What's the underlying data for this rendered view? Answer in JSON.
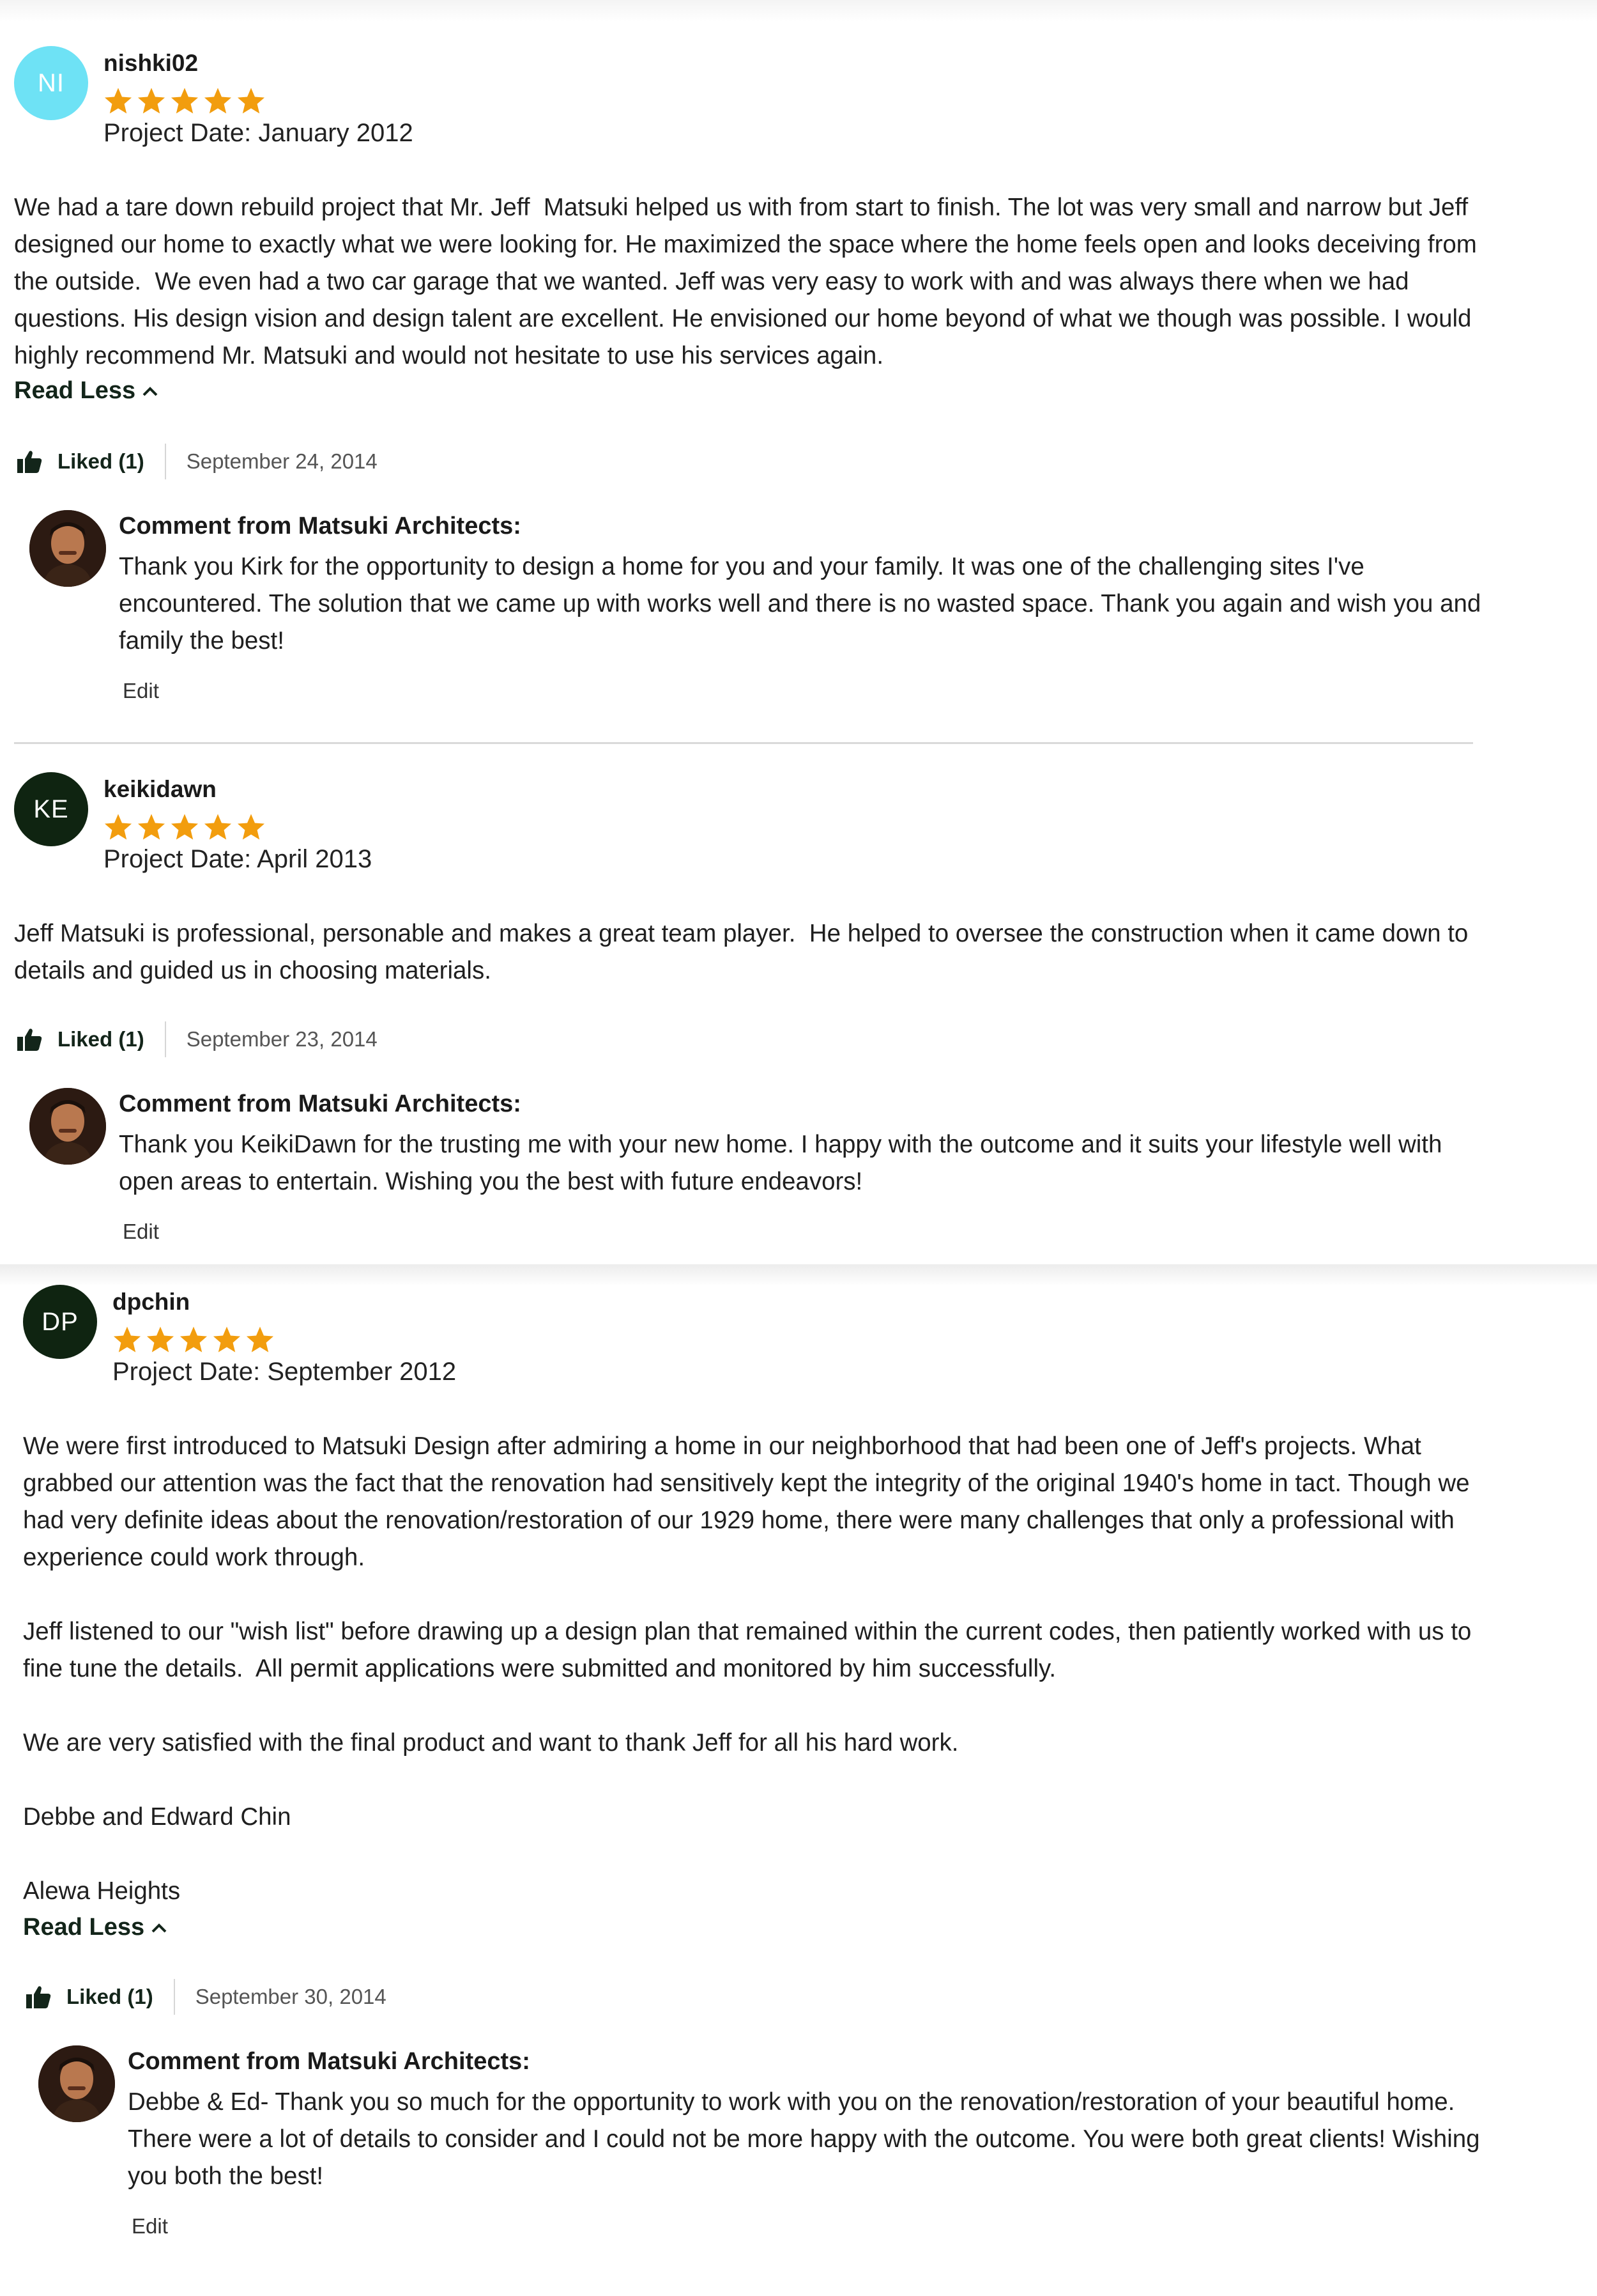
{
  "reviews": [
    {
      "initials": "NI",
      "avatar_color": "#6ee2f5",
      "username": "nishki02",
      "stars": 5,
      "project_date": "Project Date: January 2012",
      "paragraphs": [
        "We had a tare down rebuild project that Mr. Jeff  Matsuki helped us with from start to finish. The lot was very small and narrow but Jeff designed our home to exactly what we were looking for. He maximized the space where the home feels open and looks deceiving from the outside.  We even had a two car garage that we wanted. Jeff was very easy to work with and was always there when we had questions. His design vision and design talent are excellent. He envisioned our home beyond of what we though was possible. I would highly recommend Mr. Matsuki and would not hesitate to use his services again."
      ],
      "read_less": "Read Less",
      "liked": "Liked (1)",
      "date": "September 24, 2014",
      "comment_title": "Comment from Matsuki Architects:",
      "comment_text": "Thank you Kirk for the opportunity to design a home for you and your family. It was one of the challenging sites I've encountered. The solution that we came up with works well and there is no wasted space. Thank you again and wish you and family the best!",
      "edit": "Edit"
    },
    {
      "initials": "KE",
      "avatar_color": "#0f2411",
      "username": "keikidawn",
      "stars": 5,
      "project_date": "Project Date: April 2013",
      "paragraphs": [
        "Jeff Matsuki is professional, personable and makes a great team player.  He helped to oversee the construction when it came down to details and guided us in choosing materials."
      ],
      "liked": "Liked (1)",
      "date": "September 23, 2014",
      "comment_title": "Comment from Matsuki Architects:",
      "comment_text": "Thank you KeikiDawn for the trusting me with your new home. I happy with the outcome and it suits your lifestyle well with open areas to entertain. Wishing you the best with future endeavors!",
      "edit": "Edit"
    },
    {
      "initials": "DP",
      "avatar_color": "#0f2411",
      "username": "dpchin",
      "stars": 5,
      "project_date": "Project Date: September 2012",
      "paragraphs": [
        "We were first introduced to Matsuki Design after admiring a home in our neighborhood that had been one of Jeff's projects. What grabbed our attention was the fact that the renovation had sensitively kept the integrity of the original 1940's home in tact. Though we had very definite ideas about the renovation/restoration of our 1929 home, there were many challenges that only a professional with  experience could work through.",
        "Jeff listened to our \"wish list\" before drawing up a design plan that remained within the current codes, then patiently worked with us to fine tune the details.  All permit applications were submitted and monitored by him successfully.",
        "We are very satisfied with the final product and want to thank Jeff for all his hard work.",
        "Debbe and Edward Chin",
        "Alewa Heights"
      ],
      "read_less": "Read Less",
      "liked": "Liked (1)",
      "date": "September 30, 2014",
      "comment_title": "Comment from Matsuki Architects:",
      "comment_text": "Debbe & Ed- Thank you so much for the opportunity to work with you on the renovation/restoration of your beautiful home. There were a lot of details to consider and I could not be more happy with the outcome. You were both great clients! Wishing you both the best!",
      "edit": "Edit"
    }
  ],
  "colors": {
    "star": "#f29d0e",
    "accent_text": "#13251a"
  }
}
